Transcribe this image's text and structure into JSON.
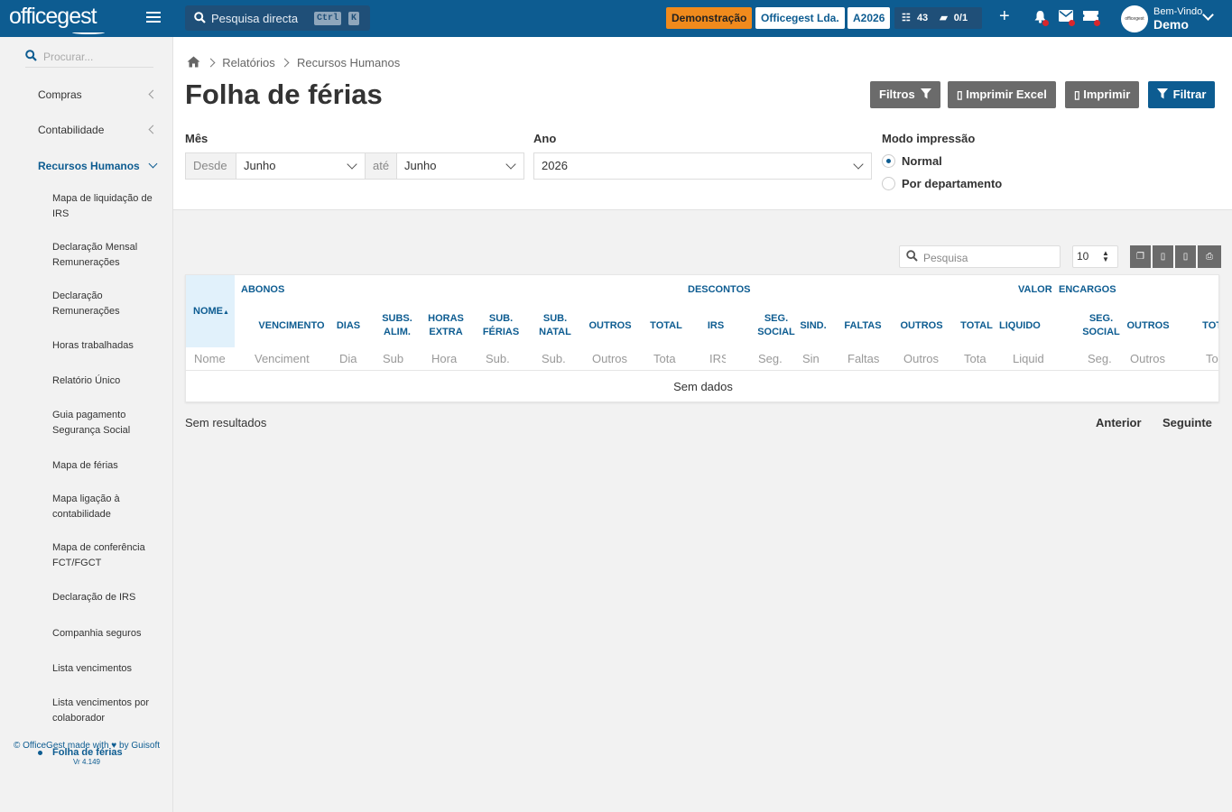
{
  "app": {
    "logo": "officegest",
    "search_placeholder": "Pesquisa directa",
    "search_kbd_1": "Ctrl",
    "search_kbd_2": "K",
    "badge_demo": "Demonstração",
    "badge_company": "Officegest Lda.",
    "badge_year": "A2026",
    "tasks_count": "43",
    "docs_count": "0/1",
    "welcome": "Bem-Vindo",
    "username": "Demo",
    "avatar_text": "officegest"
  },
  "sidebar": {
    "search_placeholder": "Procurar...",
    "compras": "Compras",
    "contabilidade": "Contabilidade",
    "rh": "Recursos Humanos",
    "sub": [
      "Mapa de liquidação de IRS",
      "Declaração Mensal Remunerações",
      "Declaração Remunerações",
      "Horas trabalhadas",
      "Relatório Único",
      "Guia pagamento Segurança Social",
      "Mapa de férias",
      "Mapa ligação à contabilidade",
      "Mapa de conferência FCT/FGCT",
      "Declaração de IRS",
      "Companhia seguros",
      "Lista vencimentos",
      "Lista vencimentos por colaborador",
      "Folha de férias"
    ],
    "footer_prefix": "© OfficeGest made with",
    "footer_suffix": "by Guisoft",
    "version": "Vr 4.149"
  },
  "page": {
    "breadcrumb_1": "Relatórios",
    "breadcrumb_2": "Recursos Humanos",
    "title": "Folha de férias",
    "btn_filtros": "Filtros",
    "btn_excel": "Imprimir Excel",
    "btn_print": "Imprimir",
    "btn_filtrar": "Filtrar"
  },
  "form": {
    "mes_label": "Mês",
    "desde": "Desde",
    "mes_from": "Junho",
    "ate": "até",
    "mes_to": "Junho",
    "ano_label": "Ano",
    "ano": "2026",
    "modo_label": "Modo impressão",
    "modo_normal": "Normal",
    "modo_dept": "Por departamento",
    "modo_selected": "Normal"
  },
  "table": {
    "search_placeholder": "Pesquisa",
    "page_size": "10",
    "groups": {
      "abonos": "ABONOS",
      "descontos": "DESCONTOS",
      "valor": "VALOR",
      "encargos": "ENCARGOS"
    },
    "col_nome": "NOME",
    "col_liquido": "LIQUIDO",
    "cols": [
      {
        "h1": "VENCIMENTO",
        "h2": "",
        "f": "Venciment"
      },
      {
        "h1": "DIAS",
        "h2": "",
        "f": "Dia"
      },
      {
        "h1": "SUBS.",
        "h2": "ALIM.",
        "f": "Sub"
      },
      {
        "h1": "HORAS",
        "h2": "EXTRA",
        "f": "Hora"
      },
      {
        "h1": "SUB.",
        "h2": "FÉRIAS",
        "f": "Sub."
      },
      {
        "h1": "SUB.",
        "h2": "NATAL",
        "f": "Sub."
      },
      {
        "h1": "OUTROS",
        "h2": "",
        "f": "Outros"
      },
      {
        "h1": "TOTAL",
        "h2": "",
        "f": "Tota"
      },
      {
        "h1": "IRS",
        "h2": "",
        "f": "IRS"
      },
      {
        "h1": "SEG.",
        "h2": "SOCIAL",
        "f": "Seg."
      },
      {
        "h1": "SIND.",
        "h2": "",
        "f": "Sin"
      },
      {
        "h1": "FALTAS",
        "h2": "",
        "f": "Faltas"
      },
      {
        "h1": "OUTROS",
        "h2": "",
        "f": "Outros"
      },
      {
        "h1": "TOTAL",
        "h2": "",
        "f": "Tota"
      },
      {
        "h1": "SEG.",
        "h2": "SOCIAL",
        "f": "Seg."
      },
      {
        "h1": "OUTROS",
        "h2": "",
        "f": "Outros"
      },
      {
        "h1": "TOTAL",
        "h2": "",
        "f": "Tota"
      }
    ],
    "filter_nome": "Nome",
    "filter_liquido": "Liquid",
    "no_data": "Sem dados",
    "no_results": "Sem resultados",
    "prev": "Anterior",
    "next": "Seguinte"
  },
  "colors": {
    "primary": "#0d5c91",
    "demo_badge": "#f08a1c",
    "gray_button": "#6b6b6b",
    "highlight": "#e1f1fb"
  }
}
